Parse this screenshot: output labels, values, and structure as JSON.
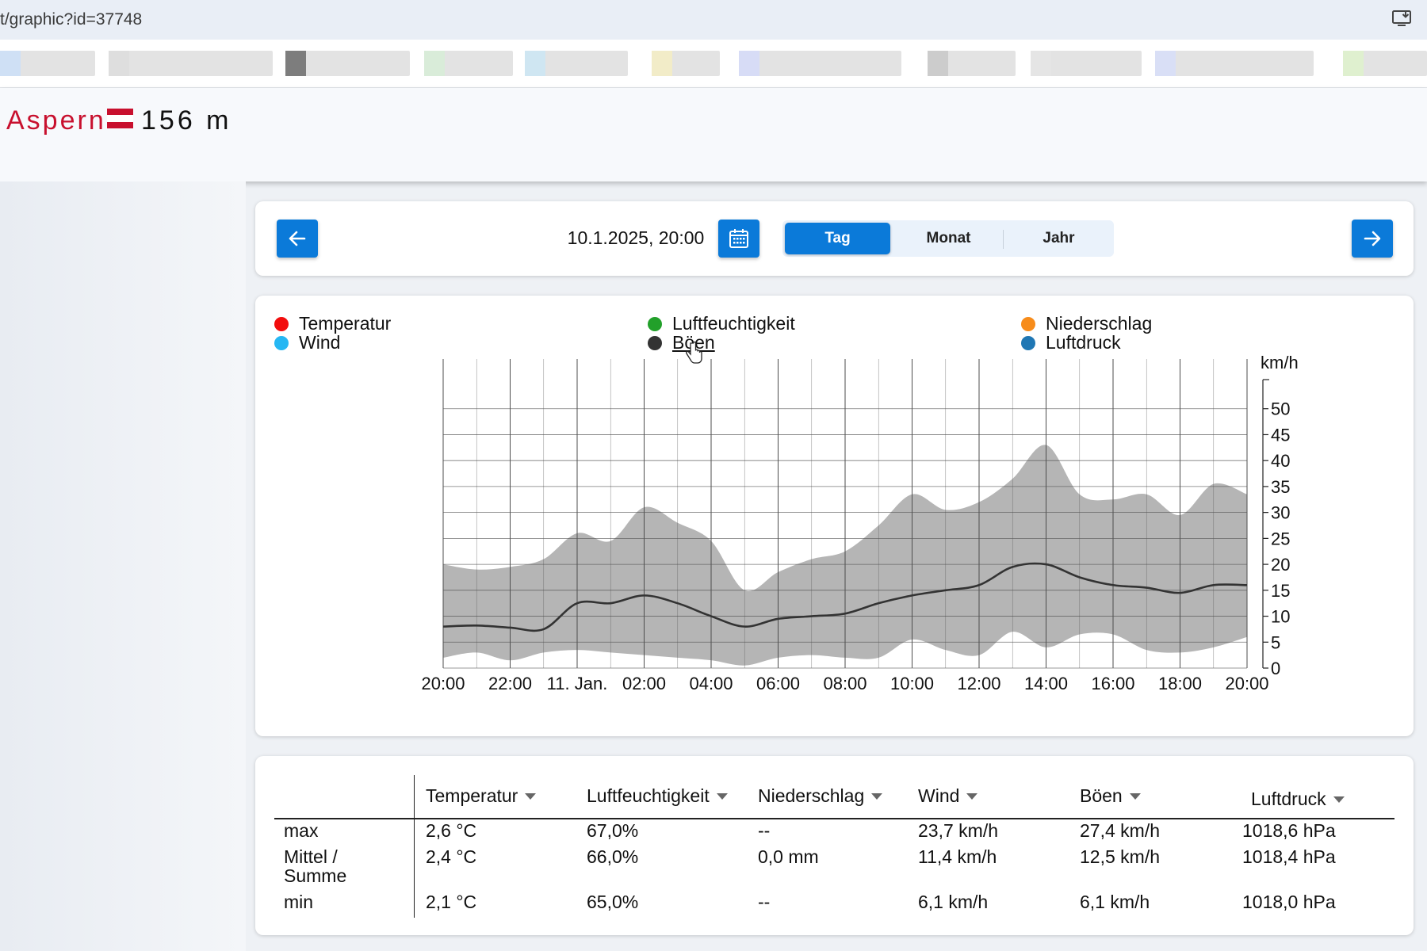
{
  "browser": {
    "url": "t/graphic?id=37748",
    "install_icon": "install-app-icon",
    "bookmark_colors": [
      "#e6e6e6",
      "#cfe0f5",
      "#dedede",
      "#7d7d7d",
      "#d9ecd9",
      "#cfe6f2",
      "#f2ecc8",
      "#d7dcf6",
      "#cccccc",
      "#e5e5e5",
      "#d9dff6",
      "#dff0cf"
    ]
  },
  "header": {
    "station": "Aspern",
    "altitude": "156 m",
    "flag_colors": [
      "#c8102e",
      "#ffffff",
      "#c8102e"
    ]
  },
  "nav": {
    "prev_icon": "arrow-left-icon",
    "next_icon": "arrow-right-icon",
    "calendar_icon": "calendar-icon",
    "date": "10.1.2025, 20:00",
    "tabs": [
      "Tag",
      "Monat",
      "Jahr"
    ],
    "active_tab": "Tag",
    "accent": "#0b7ad9"
  },
  "legend": [
    {
      "label": "Temperatur",
      "color": "#f20d0d"
    },
    {
      "label": "Wind",
      "color": "#26b7f3"
    },
    {
      "label": "Luftfeuchtigkeit",
      "color": "#22a02a"
    },
    {
      "label": "Böen",
      "color": "#333333",
      "selected": true
    },
    {
      "label": "Niederschlag",
      "color": "#f78c1b"
    },
    {
      "label": "Luftdruck",
      "color": "#1f77b4"
    }
  ],
  "chart_data": {
    "type": "area",
    "ylabel": "km/h",
    "ylim": [
      0,
      55
    ],
    "yticks": [
      0,
      5,
      10,
      15,
      20,
      25,
      30,
      35,
      40,
      45,
      50
    ],
    "x": [
      0,
      1,
      2,
      3,
      4,
      5,
      6,
      7,
      8,
      9,
      10,
      11,
      12,
      13,
      14,
      15,
      16,
      17,
      18,
      19,
      20,
      21,
      22,
      23,
      24
    ],
    "xticks": [
      {
        "at": 0,
        "label": "20:00"
      },
      {
        "at": 2,
        "label": "22:00"
      },
      {
        "at": 4,
        "label": "11. Jan."
      },
      {
        "at": 6,
        "label": "02:00"
      },
      {
        "at": 8,
        "label": "04:00"
      },
      {
        "at": 10,
        "label": "06:00"
      },
      {
        "at": 12,
        "label": "08:00"
      },
      {
        "at": 14,
        "label": "10:00"
      },
      {
        "at": 16,
        "label": "12:00"
      },
      {
        "at": 18,
        "label": "14:00"
      },
      {
        "at": 20,
        "label": "16:00"
      },
      {
        "at": 22,
        "label": "18:00"
      },
      {
        "at": 24,
        "label": "20:00"
      }
    ],
    "grid": true,
    "series": [
      {
        "name": "Böen",
        "color": "#333333",
        "band_color": "#b5b5b5",
        "mean": [
          8,
          8.2,
          7.8,
          7.5,
          12.5,
          12.5,
          14,
          12.5,
          10,
          8,
          9.5,
          10,
          10.5,
          12.5,
          14,
          15,
          16,
          19.5,
          20,
          17.5,
          16,
          15.5,
          14.5,
          16,
          16
        ],
        "max": [
          20,
          19,
          19.5,
          21,
          26,
          24.5,
          31,
          28,
          24.5,
          15,
          18.5,
          21,
          22.5,
          27.5,
          33.5,
          30.5,
          32,
          36.5,
          43,
          33.5,
          32.5,
          33.5,
          29.5,
          35.5,
          33.5
        ],
        "min": [
          2,
          3,
          1.5,
          3,
          3.5,
          3,
          2.5,
          2,
          1.5,
          0.5,
          2,
          2.5,
          2,
          2,
          5.5,
          3.5,
          2.5,
          7,
          4,
          6.5,
          6.5,
          3.5,
          3,
          4,
          6
        ]
      }
    ]
  },
  "table": {
    "columns": [
      "Temperatur",
      "Luftfeuchtigkeit",
      "Niederschlag",
      "Wind",
      "Böen",
      "Luftdruck"
    ],
    "rows": [
      {
        "label": "max",
        "values": [
          "2,6 °C",
          "67,0%",
          "--",
          "23,7 km/h",
          "27,4 km/h",
          "1018,6 hPa"
        ]
      },
      {
        "label": "Mittel / Summe",
        "values": [
          "2,4 °C",
          "66,0%",
          "0,0 mm",
          "11,4 km/h",
          "12,5 km/h",
          "1018,4 hPa"
        ]
      },
      {
        "label": "min",
        "values": [
          "2,1 °C",
          "65,0%",
          "--",
          "6,1 km/h",
          "6,1 km/h",
          "1018,0 hPa"
        ]
      }
    ]
  }
}
